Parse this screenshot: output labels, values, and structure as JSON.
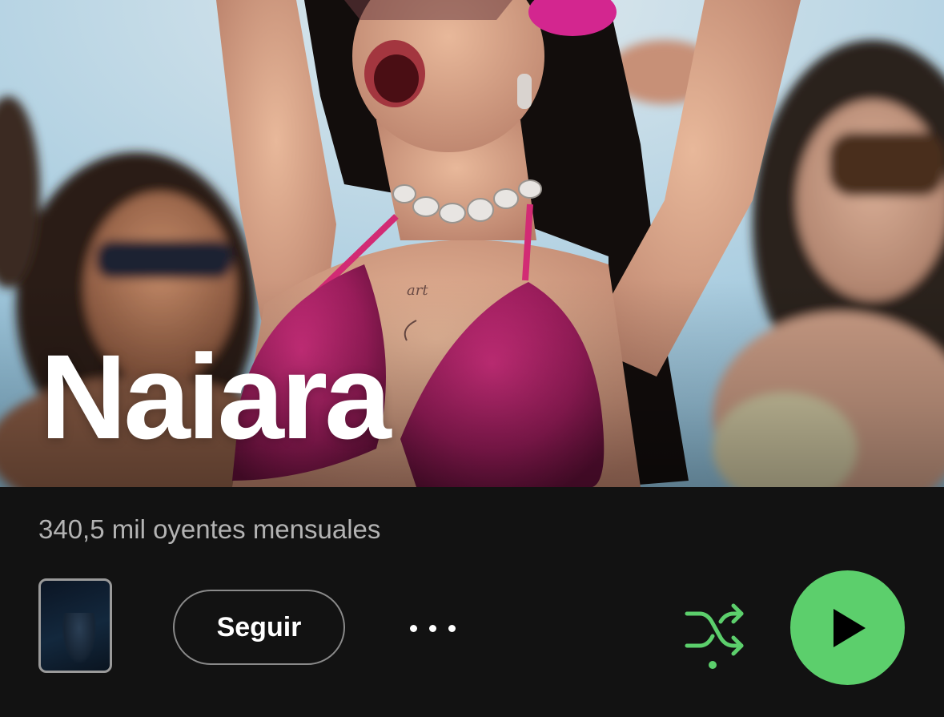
{
  "artist": {
    "name": "Naiara",
    "monthly_listeners": "340,5 mil oyentes mensuales"
  },
  "actions": {
    "follow_label": "Seguir",
    "more_icon": "more-options-icon",
    "shuffle_icon": "shuffle-icon",
    "play_icon": "play-icon"
  },
  "colors": {
    "background": "#121212",
    "accent_green": "#5ccf6c",
    "secondary_text": "#b3b3b3"
  }
}
